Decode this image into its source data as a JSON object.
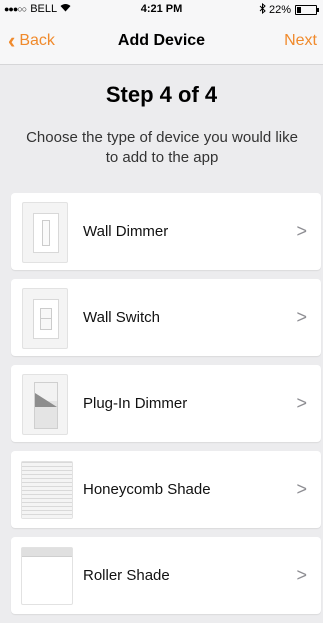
{
  "status_bar": {
    "carrier": "BELL",
    "time": "4:21 PM",
    "battery": "22%",
    "battery_level": 0.22
  },
  "nav": {
    "back_label": "Back",
    "title": "Add Device",
    "next_label": "Next"
  },
  "step_title": "Step 4 of 4",
  "instruction": "Choose the type of device you would like to add to the app",
  "devices": [
    {
      "label": "Wall Dimmer",
      "icon": "wall-dimmer-icon"
    },
    {
      "label": "Wall Switch",
      "icon": "wall-switch-icon"
    },
    {
      "label": "Plug-In Dimmer",
      "icon": "plug-in-dimmer-icon"
    },
    {
      "label": "Honeycomb Shade",
      "icon": "honeycomb-shade-icon"
    },
    {
      "label": "Roller Shade",
      "icon": "roller-shade-icon"
    }
  ],
  "colors": {
    "accent": "#f08a2c",
    "background": "#ececee"
  }
}
